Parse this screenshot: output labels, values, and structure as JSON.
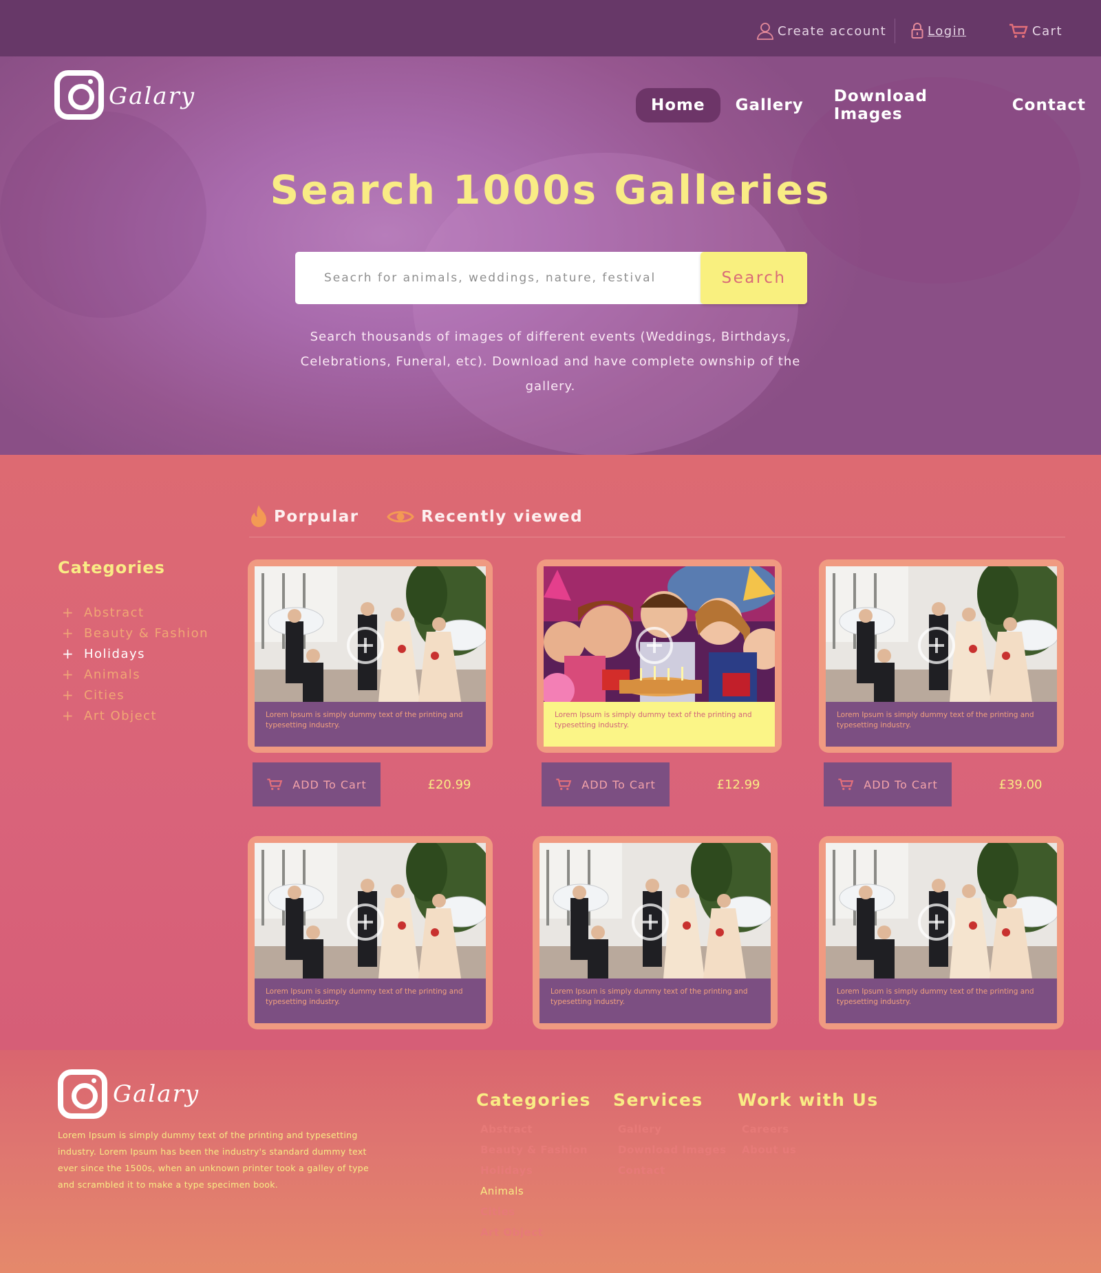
{
  "topbar": {
    "create_account": "Create account",
    "login": "Login",
    "cart": "Cart"
  },
  "brand": {
    "name": "Galary"
  },
  "nav": {
    "items": [
      {
        "label": "Home",
        "active": true
      },
      {
        "label": "Gallery",
        "active": false
      },
      {
        "label": "Download Images",
        "active": false
      },
      {
        "label": "Contact",
        "active": false
      }
    ]
  },
  "hero": {
    "title": "Search 1000s Galleries",
    "search_placeholder": "Seacrh for animals, weddings, nature, festival",
    "search_button": "Search",
    "description": "Search thousands of images of different events  (Weddings, Birthdays, Celebrations, Funeral, etc). Download and have complete ownship of the gallery."
  },
  "tabs": [
    {
      "label": "Porpular",
      "icon": "flame-icon"
    },
    {
      "label": "Recently viewed",
      "icon": "eye-icon"
    }
  ],
  "categories": {
    "title": "Categories",
    "items": [
      {
        "label": "Abstract",
        "active": false
      },
      {
        "label": "Beauty & Fashion",
        "active": false
      },
      {
        "label": "Holidays",
        "active": true
      },
      {
        "label": "Animals",
        "active": false
      },
      {
        "label": "Cities",
        "active": false
      },
      {
        "label": "Art Object",
        "active": false
      }
    ]
  },
  "cards": [
    {
      "image": "wedding-photo",
      "caption": "Lorem Ipsum is simply dummy text of the printing and typesetting industry.",
      "add_label": "ADD To Cart",
      "price": "£20.99",
      "highlighted": false
    },
    {
      "image": "birthday-party-photo",
      "caption": "Lorem Ipsum is simply dummy text of the printing and typesetting industry.",
      "add_label": "ADD To Cart",
      "price": "£12.99",
      "highlighted": true
    },
    {
      "image": "wedding-photo",
      "caption": "Lorem Ipsum is simply dummy text of the printing and typesetting industry.",
      "add_label": "ADD To Cart",
      "price": "£39.00",
      "highlighted": false
    },
    {
      "image": "wedding-photo",
      "caption": "Lorem Ipsum is simply dummy text of the printing and typesetting industry.",
      "highlighted": false
    },
    {
      "image": "wedding-photo",
      "caption": "Lorem Ipsum is simply dummy text of the printing and typesetting industry.",
      "highlighted": false
    },
    {
      "image": "wedding-photo",
      "caption": "Lorem Ipsum is simply dummy text of the printing and typesetting industry.",
      "highlighted": false
    }
  ],
  "footer": {
    "description": "Lorem Ipsum is simply dummy text of the printing and typesetting industry. Lorem Ipsum has been the industry's standard dummy text ever since the 1500s, when an unknown printer took a galley of type and scrambled it to make a type specimen book.",
    "columns": [
      {
        "title": "Categories",
        "items": [
          {
            "label": "Abstract",
            "active": false
          },
          {
            "label": "Beauty & Fashion",
            "active": false
          },
          {
            "label": "Holidays",
            "active": false
          },
          {
            "label": "Animals",
            "active": true
          },
          {
            "label": "Cities",
            "active": false
          },
          {
            "label": "Art Object",
            "active": false
          }
        ]
      },
      {
        "title": "Services",
        "items": [
          {
            "label": "Gallery",
            "active": false
          },
          {
            "label": "Download Images",
            "active": false
          },
          {
            "label": "Contact",
            "active": false
          }
        ]
      },
      {
        "title": "Work with Us",
        "items": [
          {
            "label": "Careers",
            "active": false
          },
          {
            "label": "About us",
            "active": false
          }
        ]
      }
    ]
  },
  "colors": {
    "topbar": "#673868",
    "hero_purple": "#a86aac",
    "accent_yellow": "#f9ec85",
    "card_purple": "#7c4f82",
    "main_pink": "#d9637a",
    "footer_orange": "#e5896b"
  }
}
